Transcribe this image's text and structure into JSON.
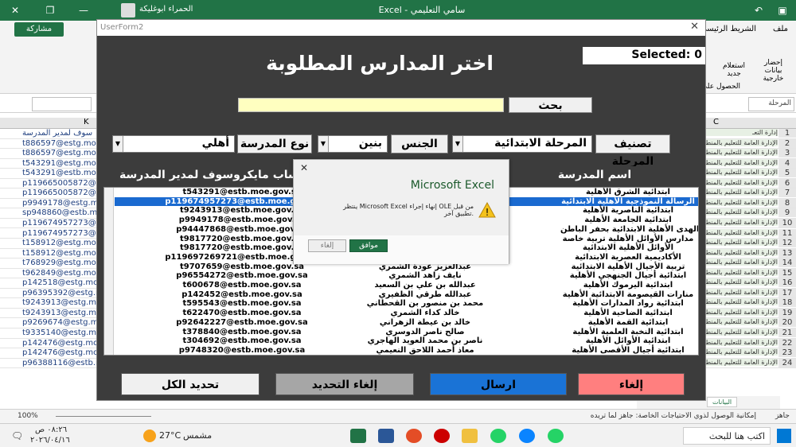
{
  "excel": {
    "title": "Excel - سامي التعليمي",
    "user": "الحمراء ابوغليكة",
    "tabs": [
      "ملف",
      "الشريط الرئيسي"
    ],
    "share_label": "مشاركة",
    "ribbon_items": [
      "إحضار بيانات خارجية",
      "استعلام جديد",
      "الحصول على"
    ],
    "namebox_value": "المرحلة",
    "column_left": "K",
    "column_right": "C",
    "left_header": "سوف لمدير المدرسة",
    "right_header": "إدارة التعـ",
    "left_cells": [
      "t886597@estg.mo",
      "t886597@estg.mo",
      "t886597@estg.mo",
      "t543291@estg.mo",
      "t543291@estb.mo",
      "p119665005872@",
      "p119665005872@",
      "p9949178@estg.mo",
      "sp948860@estb.m",
      "p119674957273@",
      "p119674957273@",
      "t158912@estg.mo",
      "t158912@estg.mo",
      "t768929@estg.mo",
      "t962849@estg.mo",
      "p142518@estg.mo",
      "p96395392@estg.m",
      "t9243913@estg.mo",
      "t9243913@estg.mo",
      "p9269674@estg.m",
      "t9335140@estg.mo",
      "p142476@estg.mo",
      "p142476@estg.mo",
      "p96388116@estb.m"
    ],
    "right_cell_text": "الإدارة العامة للتعليم بالمنط",
    "row_numbers": [
      "1",
      "2",
      "3",
      "4",
      "5",
      "6",
      "7",
      "8",
      "9",
      "10",
      "11",
      "12",
      "13",
      "14",
      "15",
      "16",
      "17",
      "18",
      "19",
      "20",
      "21",
      "22",
      "23",
      "24"
    ],
    "zoom": "100%",
    "status_left": "جاهز",
    "status_accessibility": "إمكانية الوصول لذوي الاحتياجات الخاصة: جاهز لما تريده",
    "sheet_tab": "البيانات"
  },
  "userform": {
    "caption": "UserForm2",
    "selected_label": "Selected: 0",
    "title": "اختر المدارس المطلوبة",
    "search_button": "بحث",
    "stage_label": "تصنيف المرحلة",
    "stage_value": "المرحلة الابتدائية",
    "gender_label": "الجنس",
    "gender_value": "بنين",
    "type_label": "نوع المدرسة",
    "type_value": "أهلي",
    "col_school": "اسم المدرسة",
    "col_account": "حساب مايكروسوف لمدير المدرسة",
    "rows": [
      {
        "school": "ابتدائية الشرق الأهلية",
        "name": "",
        "email": "t543291@estb.moe.gov.sa"
      },
      {
        "school": "الرسالة النموذجية الأهلية الابتدائية",
        "name": "",
        "email": "p119674957273@estb.moe.gov.sa"
      },
      {
        "school": "ابتدائية الناصرية الأهلية",
        "name": "",
        "email": "t9243913@estb.moe.gov.sa"
      },
      {
        "school": "ابتدائية الجامعة الأهلية",
        "name": "",
        "email": "p9949178@estb.moe.gov.sa"
      },
      {
        "school": "نور الهدى الأهلية الابتدائية بحفر الباطن",
        "name": "",
        "email": "p94447868@estb.moe.gov.sa"
      },
      {
        "school": "مدارس الأوائل الأهلية تربية خاصة",
        "name": "",
        "email": "t9817720@estb.moe.gov.sa"
      },
      {
        "school": "الأوائل الأهلية الابتدائية",
        "name": "",
        "email": "t9817720@estb.moe.gov.sa"
      },
      {
        "school": "الأكاديمية العصرية الابتدائية",
        "name": "",
        "email": "p119697269721@estb.moe.gov.sa"
      },
      {
        "school": "تربية الأجيال الأهلية الابتدائية",
        "name": "عبدالعزيز عودة الشمري",
        "email": "t9707659@estb.moe.gov.sa"
      },
      {
        "school": "ابتدائية أجيال الجنهجي الأهلية",
        "name": "نايف زاهد الشمري",
        "email": "p96554272@estb.moe.gov.sa"
      },
      {
        "school": "ابتدائية اليرموك الأهلية",
        "name": "عبدالله بن علي بن السعيد",
        "email": "t600678@estb.moe.gov.sa"
      },
      {
        "school": "منارات القيصومة الابتدائية الأهلية",
        "name": "عبدالله طرقي الظفيري",
        "email": "p142452@estb.moe.gov.sa"
      },
      {
        "school": "ابتدائية رواد المدارات الأهلية",
        "name": "محمد بن منصور بن القحطاني",
        "email": "t595543@estb.moe.gov.sa"
      },
      {
        "school": "ابتدائية الضاحية الأهلية",
        "name": "خالد كداء الشمري",
        "email": "t622470@estb.moe.gov.sa"
      },
      {
        "school": "ابتدائية القمة الأهلية",
        "name": "خالد بن عيطة الزهراني",
        "email": "p92642227@estb.moe.gov.sa"
      },
      {
        "school": "ابتدائية النخبة العلمية الأهلية",
        "name": "صالح ناصر الدوسري",
        "email": "t378840@estb.moe.gov.sa"
      },
      {
        "school": "ابتدائية الأوائل الأهلية",
        "name": "ناصر بن محمد العويد الهاجري",
        "email": "t304692@estb.moe.gov.sa"
      },
      {
        "school": "ابتدائية أجيال الأقصى الأهلية",
        "name": "معاذ أحمد اللاحق النعيمي",
        "email": "p9748320@estb.moe.gov.sa"
      }
    ],
    "btn_cancel": "إلغاء",
    "btn_send": "ارسال",
    "btn_unselect": "إلغاء التحديد",
    "btn_select_all": "تحديد الكل"
  },
  "msgbox": {
    "title": "Microsoft Excel",
    "message": "ينتظر Microsoft Excel إنهاء إجراء OLE من قبل تطبيق آخر.",
    "ok": "موافق",
    "cancel": "إلغاء"
  },
  "taskbar": {
    "search": "اكتب هنا للبحث",
    "weather": "27°C",
    "weather_desc": "مشمس",
    "time": "٠٨:٢٦ ص",
    "date": "٢٠٢٦/٠٤/١٦"
  },
  "colors": {
    "excel_green": "#217346",
    "form_bg": "#3c3c3c",
    "search_field": "#ffffc0",
    "btn_cancel": "#ff7f7f",
    "btn_send": "#1a73d6",
    "btn_unselect": "#a6a6a6",
    "btn_select_all": "#f0f0f0"
  }
}
